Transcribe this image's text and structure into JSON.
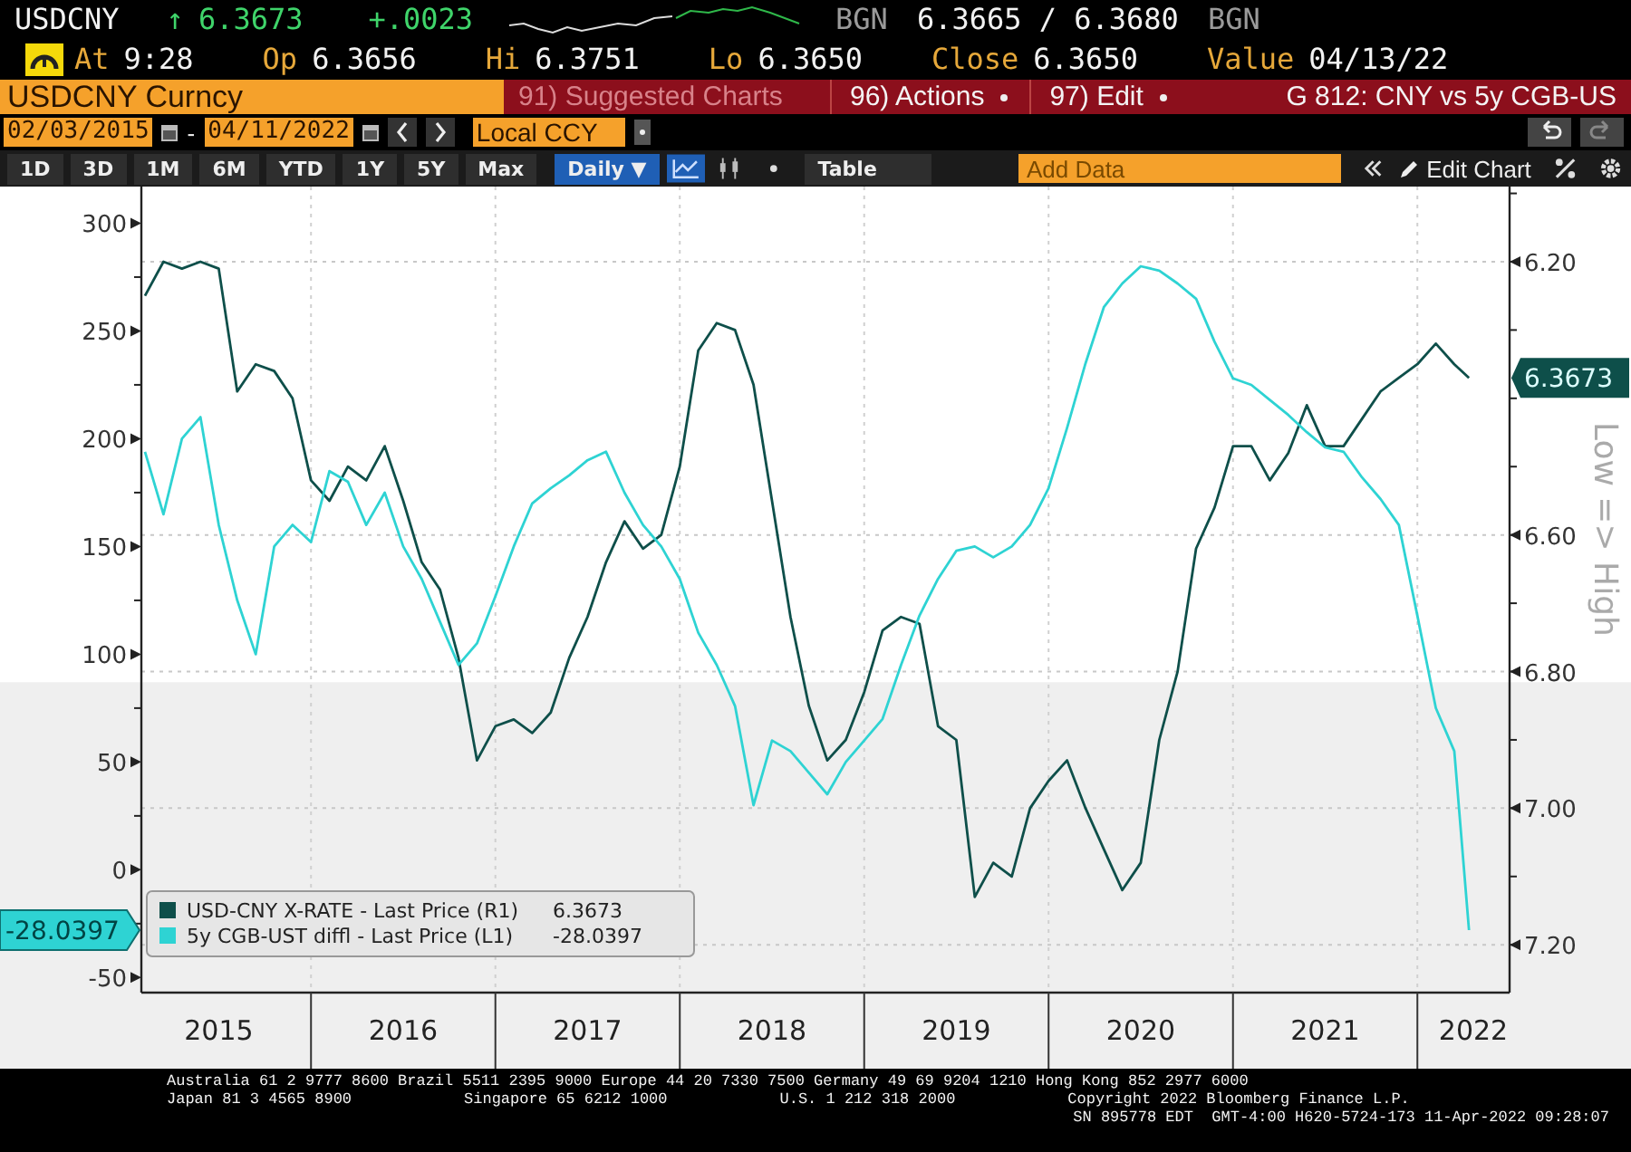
{
  "quote": {
    "ticker": "USDCNY",
    "arrow": "↑",
    "last": "6.3673",
    "change": "+.0023",
    "source": "BGN",
    "bid_ask": "6.3665 / 6.3680",
    "source_2": "BGN"
  },
  "stats": [
    {
      "label": "At",
      "value": "9:28"
    },
    {
      "label": "Op",
      "value": "6.3656"
    },
    {
      "label": "Hi",
      "value": "6.3751"
    },
    {
      "label": "Lo",
      "value": "6.3650"
    },
    {
      "label": "Close",
      "value": "6.3650"
    },
    {
      "label": "Value",
      "value": "04/13/22"
    }
  ],
  "security_field": {
    "value": "USDCNY Curncy"
  },
  "menu": [
    {
      "label": "91) Suggested Charts",
      "disabled": true,
      "dropdown": false
    },
    {
      "label": "96) Actions",
      "disabled": false,
      "dropdown": true
    },
    {
      "label": "97) Edit",
      "disabled": false,
      "dropdown": true
    }
  ],
  "chart_title": "G 812: CNY vs 5y CGB-US",
  "date_range": {
    "start": "02/03/2015",
    "separator": "-",
    "end": "04/11/2022"
  },
  "currency_field": {
    "value": "Local CCY"
  },
  "ranges": [
    {
      "label": "1D",
      "selected": false
    },
    {
      "label": "3D",
      "selected": false
    },
    {
      "label": "1M",
      "selected": false
    },
    {
      "label": "6M",
      "selected": false
    },
    {
      "label": "YTD",
      "selected": false
    },
    {
      "label": "1Y",
      "selected": false
    },
    {
      "label": "5Y",
      "selected": false
    },
    {
      "label": "Max",
      "selected": false
    }
  ],
  "frequency": {
    "label": "Daily ▼",
    "selected": true
  },
  "line_chart_toggle": {
    "selected": true
  },
  "table_button": "Table",
  "add_data": {
    "placeholder": "Add Data"
  },
  "edit_chart": "Edit Chart",
  "chart": {
    "chart_data": {
      "type": "line",
      "ylim": [
        -57,
        317
      ],
      "y2lim": [
        7.27,
        6.09
      ],
      "xlim": [
        2014.58,
        2022.0
      ],
      "xticks": [
        2015,
        2016,
        2017,
        2018,
        2019,
        2020,
        2021,
        2022
      ],
      "grid": true,
      "legend": true,
      "bands": [
        {
          "axis": "y",
          "from": -57,
          "to": 87,
          "color": "#efefef"
        }
      ],
      "yticks": [
        -50,
        0,
        50,
        100,
        150,
        200,
        250,
        300
      ],
      "y2ticks": [
        {
          "value": 6.2,
          "label": "6.20"
        },
        {
          "value": 6.6,
          "label": "6.60"
        },
        {
          "value": 6.8,
          "label": "6.80"
        },
        {
          "value": 7.0,
          "label": "7.00"
        },
        {
          "value": 7.2,
          "label": "7.20"
        }
      ],
      "y2label": "Low => High",
      "x": [
        2014.6,
        2014.7,
        2014.8,
        2014.9,
        2015.0,
        2015.1,
        2015.2,
        2015.3,
        2015.4,
        2015.5,
        2015.6,
        2015.7,
        2015.8,
        2015.9,
        2016.0,
        2016.1,
        2016.2,
        2016.3,
        2016.4,
        2016.5,
        2016.6,
        2016.7,
        2016.8,
        2016.9,
        2017.0,
        2017.1,
        2017.2,
        2017.3,
        2017.4,
        2017.5,
        2017.6,
        2017.7,
        2017.8,
        2017.9,
        2018.0,
        2018.1,
        2018.2,
        2018.3,
        2018.4,
        2018.5,
        2018.6,
        2018.7,
        2018.8,
        2018.9,
        2019.0,
        2019.1,
        2019.2,
        2019.3,
        2019.4,
        2019.5,
        2019.6,
        2019.7,
        2019.8,
        2019.9,
        2020.0,
        2020.1,
        2020.2,
        2020.3,
        2020.4,
        2020.5,
        2020.6,
        2020.7,
        2020.8,
        2020.9,
        2021.0,
        2021.1,
        2021.2,
        2021.3,
        2021.4,
        2021.5,
        2021.6,
        2021.7,
        2021.78
      ],
      "series": [
        {
          "name": "USD-CNY X-RATE - Last Price (R1)",
          "color": "#0e4f4a",
          "axis": "y2",
          "values": [
            6.25,
            6.2,
            6.21,
            6.2,
            6.21,
            6.39,
            6.35,
            6.36,
            6.4,
            6.52,
            6.55,
            6.5,
            6.52,
            6.47,
            6.55,
            6.64,
            6.68,
            6.78,
            6.93,
            6.88,
            6.87,
            6.89,
            6.86,
            6.78,
            6.72,
            6.64,
            6.58,
            6.62,
            6.6,
            6.5,
            6.33,
            6.29,
            6.3,
            6.38,
            6.55,
            6.72,
            6.85,
            6.93,
            6.9,
            6.83,
            6.74,
            6.72,
            6.73,
            6.88,
            6.9,
            7.13,
            7.08,
            7.1,
            7.0,
            6.96,
            6.93,
            7.0,
            7.06,
            7.12,
            7.08,
            6.9,
            6.8,
            6.62,
            6.56,
            6.47,
            6.47,
            6.52,
            6.48,
            6.41,
            6.47,
            6.47,
            6.43,
            6.39,
            6.37,
            6.35,
            6.32,
            6.35,
            6.37
          ]
        },
        {
          "name": "5y CGB-UST diffl - Last Price (L1)",
          "color": "#2ed3d3",
          "values": [
            194,
            165,
            200,
            210,
            160,
            125,
            100,
            150,
            160,
            152,
            185,
            180,
            160,
            175,
            150,
            135,
            115,
            95,
            105,
            127,
            150,
            170,
            177,
            183,
            190,
            194,
            175,
            160,
            150,
            135,
            110,
            95,
            76,
            30,
            60,
            55,
            45,
            35,
            50,
            60,
            70,
            95,
            118,
            135,
            148,
            150,
            145,
            150,
            160,
            177,
            205,
            235,
            261,
            272,
            280,
            278,
            272,
            265,
            245,
            228,
            225,
            218,
            211,
            203,
            196,
            194,
            182,
            172,
            160,
            118,
            75,
            55,
            -28
          ]
        }
      ]
    },
    "legend": [
      {
        "value": "6.3673"
      },
      {
        "value": "-28.0397"
      }
    ],
    "left_tag": "-28.0397",
    "right_tag": "6.3673"
  },
  "footer": {
    "line_1": [
      "Australia 61 2 9777 8600 Brazil 5511 2395 9000 Europe 44 20 7330 7500 Germany 49 69 9204 1210 Hong Kong 852 2977 6000"
    ],
    "line_2": [
      "Japan 81 3 4565 8900",
      "Singapore 65 6212 1000",
      "U.S. 1 212 318 2000",
      "Copyright 2022 Bloomberg Finance L.P."
    ],
    "line_3": [
      "SN 895778 EDT  GMT-4:00 H620-5724-173 11-Apr-2022 09:28:07"
    ]
  }
}
